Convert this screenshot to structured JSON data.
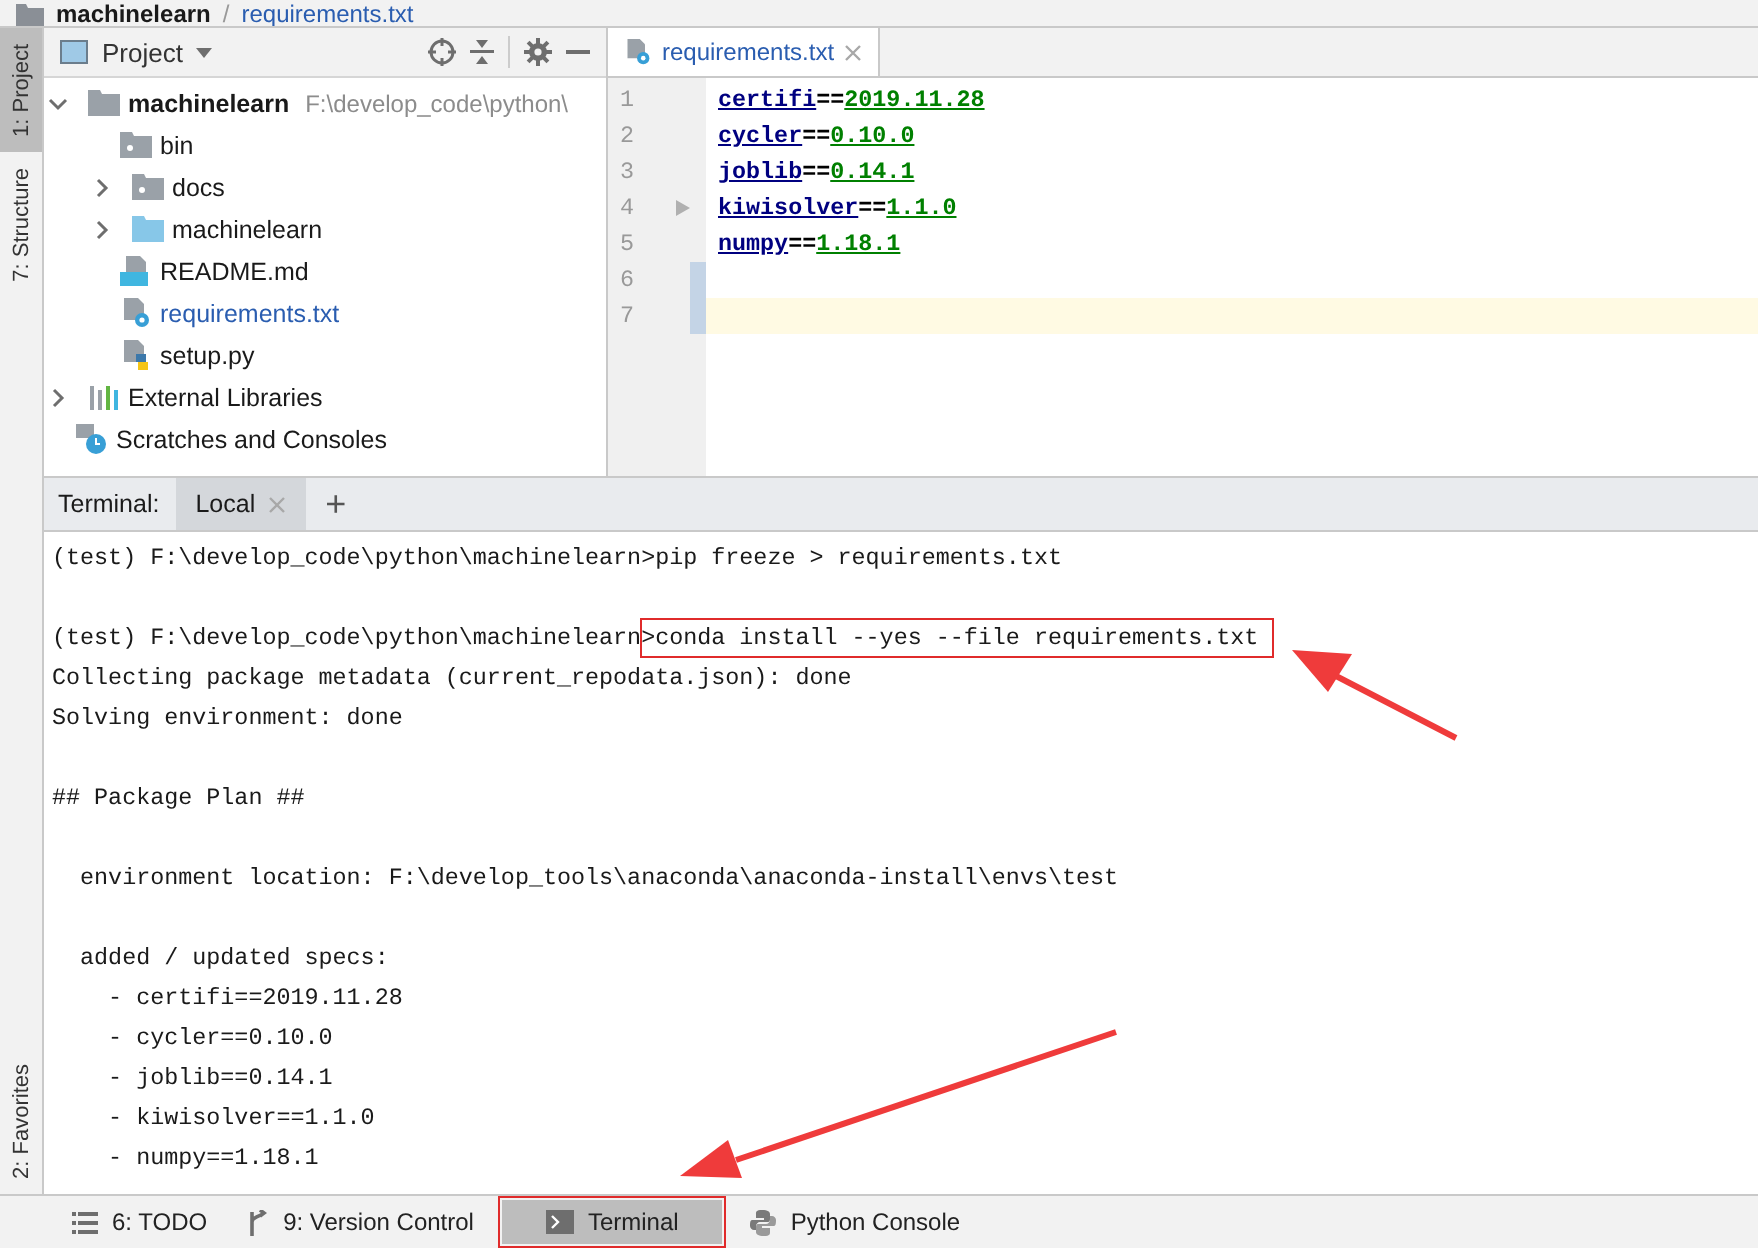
{
  "breadcrumb": {
    "project": "machinelearn",
    "separator": "/",
    "file": "requirements.txt"
  },
  "side_tabs_top": [
    {
      "label": "1: Project",
      "selected": true
    },
    {
      "label": "7: Structure",
      "selected": false
    }
  ],
  "side_tabs_bottom": [
    {
      "label": "2: Favorites",
      "selected": false
    }
  ],
  "project_panel": {
    "title": "Project",
    "tree": [
      {
        "label": "machinelearn",
        "hint": "F:\\develop_code\\python\\",
        "kind": "folder",
        "expanded": true,
        "highlighted": false,
        "children": [
          {
            "label": "bin",
            "kind": "folder-dot",
            "highlighted": false
          },
          {
            "label": "docs",
            "kind": "folder-dot",
            "expanded": false,
            "highlighted": false
          },
          {
            "label": "machinelearn",
            "kind": "folder-blue",
            "expanded": false,
            "highlighted": false
          },
          {
            "label": "README.md",
            "kind": "md",
            "highlighted": false
          },
          {
            "label": "requirements.txt",
            "kind": "txt",
            "highlighted": true
          },
          {
            "label": "setup.py",
            "kind": "py",
            "highlighted": false
          }
        ]
      },
      {
        "label": "External Libraries",
        "kind": "library",
        "expanded": false,
        "highlighted": false
      },
      {
        "label": "Scratches and Consoles",
        "kind": "scratch",
        "highlighted": false
      }
    ]
  },
  "editor": {
    "tabs": [
      {
        "label": "requirements.txt",
        "selected": true
      }
    ],
    "lines": [
      {
        "number": "1",
        "name": "certifi",
        "op": "==",
        "version": "2019.11.28",
        "current": false,
        "changed": false
      },
      {
        "number": "2",
        "name": "cycler",
        "op": "==",
        "version": "0.10.0",
        "current": false,
        "changed": false
      },
      {
        "number": "3",
        "name": "joblib",
        "op": "==",
        "version": "0.14.1",
        "current": false,
        "changed": false
      },
      {
        "number": "4",
        "name": "kiwisolver",
        "op": "==",
        "version": "1.1.0",
        "current": false,
        "changed": false
      },
      {
        "number": "5",
        "name": "numpy",
        "op": "==",
        "version": "1.18.1",
        "current": false,
        "changed": false
      },
      {
        "number": "6",
        "current": false,
        "changed": true
      },
      {
        "number": "7",
        "current": true,
        "changed": true
      }
    ]
  },
  "terminal": {
    "label": "Terminal:",
    "tabs": [
      {
        "label": "Local",
        "selected": true
      }
    ],
    "add": "+",
    "blocks": [
      [
        {
          "text": "(test) F:\\develop_code\\python\\machinelearn>pip freeze > requirements.txt"
        }
      ],
      [
        {
          "text": "(test) F:\\develop_code\\python\\machinelearn",
          "command": ">conda install --yes --file requirements.txt ",
          "highlighted": true
        },
        {
          "text": "Collecting package metadata (current_repodata.json): done"
        },
        {
          "text": "Solving environment: done"
        }
      ],
      [
        {
          "text": "## Package Plan ##"
        }
      ],
      [
        {
          "text": "  environment location: F:\\develop_tools\\anaconda\\anaconda-install\\envs\\test"
        }
      ],
      [
        {
          "text": "  added / updated specs:"
        },
        {
          "text": "    - certifi==2019.11.28"
        },
        {
          "text": "    - cycler==0.10.0"
        },
        {
          "text": "    - joblib==0.14.1"
        },
        {
          "text": "    - kiwisolver==1.1.0"
        },
        {
          "text": "    - numpy==1.18.1"
        }
      ]
    ]
  },
  "bottom_bar": [
    {
      "label": "6: TODO",
      "kind": "todo",
      "selected": false,
      "highlighted": false
    },
    {
      "label": "9: Version Control",
      "kind": "vcs",
      "selected": false,
      "highlighted": false
    },
    {
      "label": "Terminal",
      "kind": "terminal",
      "selected": true,
      "highlighted": true
    },
    {
      "label": "Python Console",
      "kind": "python",
      "selected": false,
      "highlighted": false
    }
  ]
}
